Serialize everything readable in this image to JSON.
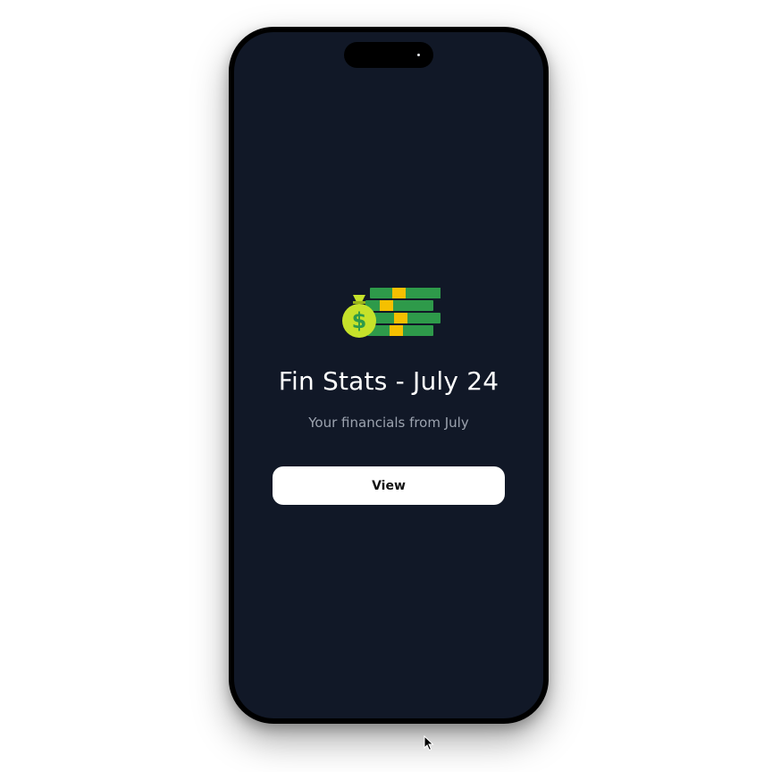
{
  "app": {
    "title": "Fin Stats - July 24",
    "subtitle": "Your financials from July"
  },
  "actions": {
    "view_label": "View"
  },
  "icons": {
    "hero": "money-bag-cash-stack-icon",
    "cursor": "mouse-pointer-icon"
  },
  "colors": {
    "screen_background": "#111827",
    "title_text": "#ffffff",
    "subtitle_text": "#9ca3af",
    "button_background": "#ffffff",
    "button_text": "#111111",
    "cash_green": "#2e9a4a",
    "cash_band": "#f5c000",
    "money_bag": "#c6e22a"
  }
}
